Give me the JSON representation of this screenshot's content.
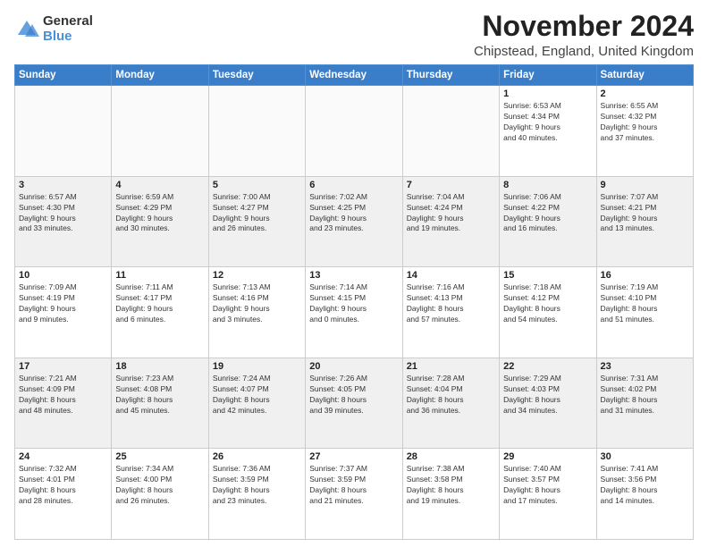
{
  "logo": {
    "general": "General",
    "blue": "Blue"
  },
  "title": "November 2024",
  "subtitle": "Chipstead, England, United Kingdom",
  "weekdays": [
    "Sunday",
    "Monday",
    "Tuesday",
    "Wednesday",
    "Thursday",
    "Friday",
    "Saturday"
  ],
  "weeks": [
    [
      {
        "day": "",
        "info": ""
      },
      {
        "day": "",
        "info": ""
      },
      {
        "day": "",
        "info": ""
      },
      {
        "day": "",
        "info": ""
      },
      {
        "day": "",
        "info": ""
      },
      {
        "day": "1",
        "info": "Sunrise: 6:53 AM\nSunset: 4:34 PM\nDaylight: 9 hours\nand 40 minutes."
      },
      {
        "day": "2",
        "info": "Sunrise: 6:55 AM\nSunset: 4:32 PM\nDaylight: 9 hours\nand 37 minutes."
      }
    ],
    [
      {
        "day": "3",
        "info": "Sunrise: 6:57 AM\nSunset: 4:30 PM\nDaylight: 9 hours\nand 33 minutes."
      },
      {
        "day": "4",
        "info": "Sunrise: 6:59 AM\nSunset: 4:29 PM\nDaylight: 9 hours\nand 30 minutes."
      },
      {
        "day": "5",
        "info": "Sunrise: 7:00 AM\nSunset: 4:27 PM\nDaylight: 9 hours\nand 26 minutes."
      },
      {
        "day": "6",
        "info": "Sunrise: 7:02 AM\nSunset: 4:25 PM\nDaylight: 9 hours\nand 23 minutes."
      },
      {
        "day": "7",
        "info": "Sunrise: 7:04 AM\nSunset: 4:24 PM\nDaylight: 9 hours\nand 19 minutes."
      },
      {
        "day": "8",
        "info": "Sunrise: 7:06 AM\nSunset: 4:22 PM\nDaylight: 9 hours\nand 16 minutes."
      },
      {
        "day": "9",
        "info": "Sunrise: 7:07 AM\nSunset: 4:21 PM\nDaylight: 9 hours\nand 13 minutes."
      }
    ],
    [
      {
        "day": "10",
        "info": "Sunrise: 7:09 AM\nSunset: 4:19 PM\nDaylight: 9 hours\nand 9 minutes."
      },
      {
        "day": "11",
        "info": "Sunrise: 7:11 AM\nSunset: 4:17 PM\nDaylight: 9 hours\nand 6 minutes."
      },
      {
        "day": "12",
        "info": "Sunrise: 7:13 AM\nSunset: 4:16 PM\nDaylight: 9 hours\nand 3 minutes."
      },
      {
        "day": "13",
        "info": "Sunrise: 7:14 AM\nSunset: 4:15 PM\nDaylight: 9 hours\nand 0 minutes."
      },
      {
        "day": "14",
        "info": "Sunrise: 7:16 AM\nSunset: 4:13 PM\nDaylight: 8 hours\nand 57 minutes."
      },
      {
        "day": "15",
        "info": "Sunrise: 7:18 AM\nSunset: 4:12 PM\nDaylight: 8 hours\nand 54 minutes."
      },
      {
        "day": "16",
        "info": "Sunrise: 7:19 AM\nSunset: 4:10 PM\nDaylight: 8 hours\nand 51 minutes."
      }
    ],
    [
      {
        "day": "17",
        "info": "Sunrise: 7:21 AM\nSunset: 4:09 PM\nDaylight: 8 hours\nand 48 minutes."
      },
      {
        "day": "18",
        "info": "Sunrise: 7:23 AM\nSunset: 4:08 PM\nDaylight: 8 hours\nand 45 minutes."
      },
      {
        "day": "19",
        "info": "Sunrise: 7:24 AM\nSunset: 4:07 PM\nDaylight: 8 hours\nand 42 minutes."
      },
      {
        "day": "20",
        "info": "Sunrise: 7:26 AM\nSunset: 4:05 PM\nDaylight: 8 hours\nand 39 minutes."
      },
      {
        "day": "21",
        "info": "Sunrise: 7:28 AM\nSunset: 4:04 PM\nDaylight: 8 hours\nand 36 minutes."
      },
      {
        "day": "22",
        "info": "Sunrise: 7:29 AM\nSunset: 4:03 PM\nDaylight: 8 hours\nand 34 minutes."
      },
      {
        "day": "23",
        "info": "Sunrise: 7:31 AM\nSunset: 4:02 PM\nDaylight: 8 hours\nand 31 minutes."
      }
    ],
    [
      {
        "day": "24",
        "info": "Sunrise: 7:32 AM\nSunset: 4:01 PM\nDaylight: 8 hours\nand 28 minutes."
      },
      {
        "day": "25",
        "info": "Sunrise: 7:34 AM\nSunset: 4:00 PM\nDaylight: 8 hours\nand 26 minutes."
      },
      {
        "day": "26",
        "info": "Sunrise: 7:36 AM\nSunset: 3:59 PM\nDaylight: 8 hours\nand 23 minutes."
      },
      {
        "day": "27",
        "info": "Sunrise: 7:37 AM\nSunset: 3:59 PM\nDaylight: 8 hours\nand 21 minutes."
      },
      {
        "day": "28",
        "info": "Sunrise: 7:38 AM\nSunset: 3:58 PM\nDaylight: 8 hours\nand 19 minutes."
      },
      {
        "day": "29",
        "info": "Sunrise: 7:40 AM\nSunset: 3:57 PM\nDaylight: 8 hours\nand 17 minutes."
      },
      {
        "day": "30",
        "info": "Sunrise: 7:41 AM\nSunset: 3:56 PM\nDaylight: 8 hours\nand 14 minutes."
      }
    ]
  ]
}
